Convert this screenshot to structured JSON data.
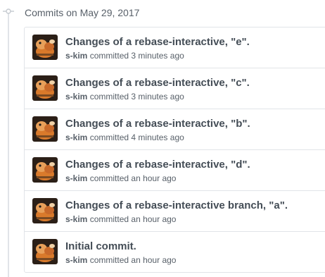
{
  "group": {
    "header": "Commits on May 29, 2017"
  },
  "commits": [
    {
      "title": "Changes of a rebase-interactive, \"e\".",
      "author": "s-kim",
      "action": "committed",
      "time": "3 minutes ago"
    },
    {
      "title": "Changes of a rebase-interactive, \"c\".",
      "author": "s-kim",
      "action": "committed",
      "time": "3 minutes ago"
    },
    {
      "title": "Changes of a rebase-interactive, \"b\".",
      "author": "s-kim",
      "action": "committed",
      "time": "4 minutes ago"
    },
    {
      "title": "Changes of a rebase-interactive, \"d\".",
      "author": "s-kim",
      "action": "committed",
      "time": "an hour ago"
    },
    {
      "title": "Changes of a rebase-interactive branch, \"a\".",
      "author": "s-kim",
      "action": "committed",
      "time": "an hour ago"
    },
    {
      "title": "Initial commit.",
      "author": "s-kim",
      "action": "committed",
      "time": "an hour ago"
    }
  ],
  "icons": {
    "commit_node": "git-commit-icon",
    "avatar": "user-avatar"
  },
  "colors": {
    "text_primary": "#444d56",
    "text_secondary": "#586069",
    "border": "#e1e4e8"
  }
}
